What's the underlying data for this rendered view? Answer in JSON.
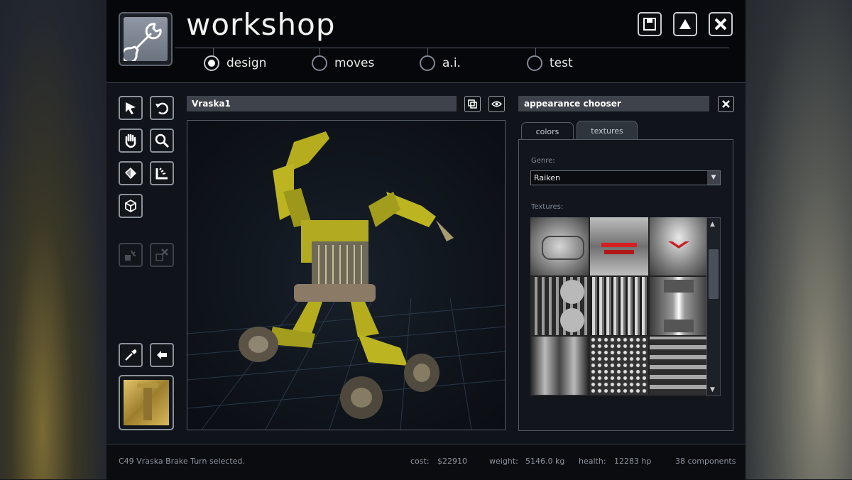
{
  "app": {
    "title": "workshop"
  },
  "window_buttons": [
    {
      "name": "save-button",
      "icon": "floppy-disk-icon"
    },
    {
      "name": "up-button",
      "icon": "triangle-up-icon"
    },
    {
      "name": "close-button",
      "icon": "close-icon"
    }
  ],
  "tabs": [
    {
      "label": "design",
      "selected": true
    },
    {
      "label": "moves",
      "selected": false
    },
    {
      "label": "a.i.",
      "selected": false
    },
    {
      "label": "test",
      "selected": false
    }
  ],
  "tools": [
    {
      "name": "select-tool",
      "icon": "arrow-cursor-icon"
    },
    {
      "name": "rotate-tool",
      "icon": "rotate-arrow-icon"
    },
    {
      "name": "pan-tool",
      "icon": "hand-icon"
    },
    {
      "name": "zoom-tool",
      "icon": "magnifier-icon"
    },
    {
      "name": "paint-tool",
      "icon": "paint-bucket-icon"
    },
    {
      "name": "snap-tool",
      "icon": "angle-snap-icon"
    },
    {
      "name": "wireframe-tool",
      "icon": "cube-icon"
    },
    {
      "name": "attach-tool",
      "icon": "attach-icon"
    },
    {
      "name": "detach-tool",
      "icon": "detach-icon"
    },
    {
      "name": "eyedropper-tool",
      "icon": "eyedropper-icon"
    },
    {
      "name": "apply-tool",
      "icon": "apply-arrow-icon"
    }
  ],
  "robot_name": "Vraska1",
  "appearance": {
    "title": "appearance chooser",
    "tabs": [
      {
        "label": "colors",
        "selected": false
      },
      {
        "label": "textures",
        "selected": true
      }
    ],
    "genre_label": "Genre:",
    "genre_value": "Raiken",
    "textures_label": "Textures:"
  },
  "footer": {
    "status": "C49 Vraska Brake Turn selected.",
    "cost_label": "cost:",
    "cost_value": "$22910",
    "weight_label": "weight:",
    "weight_value": "5146.0 kg",
    "health_label": "health:",
    "health_value": "12283 hp",
    "components": "38 components"
  },
  "colors": {
    "accent_yellow": "#c8c22a",
    "panel_bar": "#3e434b",
    "background": "#101319"
  }
}
